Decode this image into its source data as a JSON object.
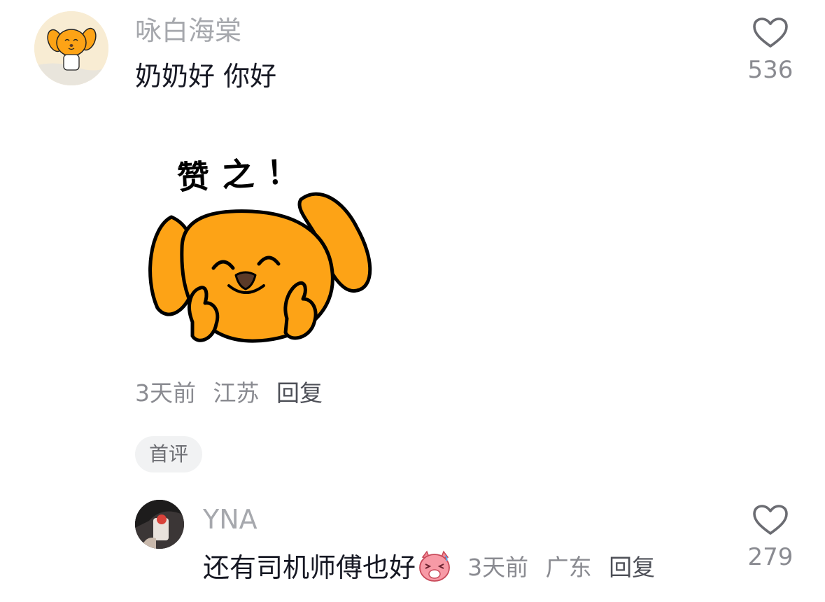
{
  "comments": [
    {
      "username": "咏白海棠",
      "text": "奶奶好 你好",
      "sticker_caption": "赞之！",
      "time": "3天前",
      "location": "江苏",
      "reply_label": "回复",
      "likes": "536",
      "badge": "首评"
    },
    {
      "username": "YNA",
      "text": "还有司机师傅也好",
      "time": "3天前",
      "location": "广东",
      "reply_label": "回复",
      "likes": "279"
    }
  ],
  "icons": {
    "like": "heart-outline-icon",
    "emoji": "laughing-pig-emoji-icon",
    "sticker": "thumbs-up-dog-sticker"
  },
  "colors": {
    "username": "#a6a8ad",
    "meta": "#8a8b91",
    "sticker_orange": "#fda316",
    "badge_bg": "#f1f2f3"
  }
}
